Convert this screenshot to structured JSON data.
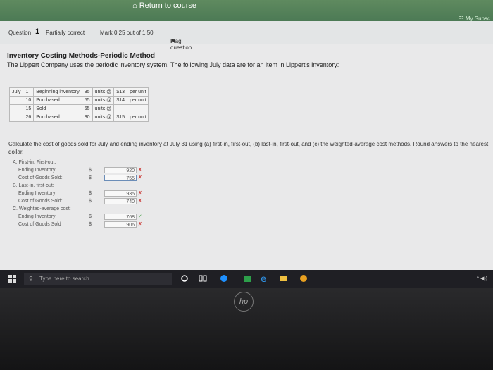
{
  "header": {
    "return_label": "Return to course",
    "my_sub_label": "My Subsc"
  },
  "question_bar": {
    "question_label": "Question",
    "question_number": "1",
    "status": "Partially correct",
    "mark": "Mark 0.25 out of 1.50",
    "flag_label": "Flag question"
  },
  "question": {
    "title": "Inventory Costing Methods-Periodic Method",
    "intro": "The Lippert Company uses the periodic inventory system. The following July data are for an item in Lippert's inventory:",
    "rows": [
      {
        "month": "July",
        "day": "1",
        "desc": "Beginning inventory",
        "units": "35",
        "unit_label": "units @",
        "cost": "$13",
        "per": "per unit"
      },
      {
        "month": "",
        "day": "10",
        "desc": "Purchased",
        "units": "55",
        "unit_label": "units @",
        "cost": "$14",
        "per": "per unit"
      },
      {
        "month": "",
        "day": "15",
        "desc": "Sold",
        "units": "65",
        "unit_label": "units @",
        "cost": "",
        "per": ""
      },
      {
        "month": "",
        "day": "26",
        "desc": "Purchased",
        "units": "30",
        "unit_label": "units @",
        "cost": "$15",
        "per": "per unit"
      }
    ],
    "calc_text": "Calculate the cost of goods sold for July and ending inventory at July 31 using (a) first-in, first-out, (b) last-in, first-out, and (c) the weighted-average cost methods. Round answers to the nearest dollar."
  },
  "answers": {
    "a": {
      "header": "A. First-in, First-out:",
      "ending_label": "Ending Inventory",
      "ending_dollar": "$",
      "ending_value": "920",
      "ending_mark": "✗",
      "cogs_label": "Cost of Goods Sold:",
      "cogs_dollar": "$",
      "cogs_value": "755",
      "cogs_mark": "✗"
    },
    "b": {
      "header": "B. Last-in, first-out:",
      "ending_label": "Ending Inventory",
      "ending_dollar": "$",
      "ending_value": "935",
      "ending_mark": "✗",
      "cogs_label": "Cost of Goods Sold:",
      "cogs_dollar": "$",
      "cogs_value": "740",
      "cogs_mark": "✗"
    },
    "c": {
      "header": "C. Weighted-average cost:",
      "ending_label": "Ending Inventory",
      "ending_dollar": "$",
      "ending_value": "768",
      "ending_mark": "✓",
      "cogs_label": "Cost of Goods Sold",
      "cogs_dollar": "$",
      "cogs_value": "906",
      "cogs_mark": "✗"
    }
  },
  "taskbar": {
    "search_placeholder": "Type here to search"
  },
  "laptop": {
    "logo": "hp"
  },
  "colors": {
    "topbar": "#4c7a55",
    "wrong": "#c9302c",
    "right": "#3b9a3b"
  }
}
